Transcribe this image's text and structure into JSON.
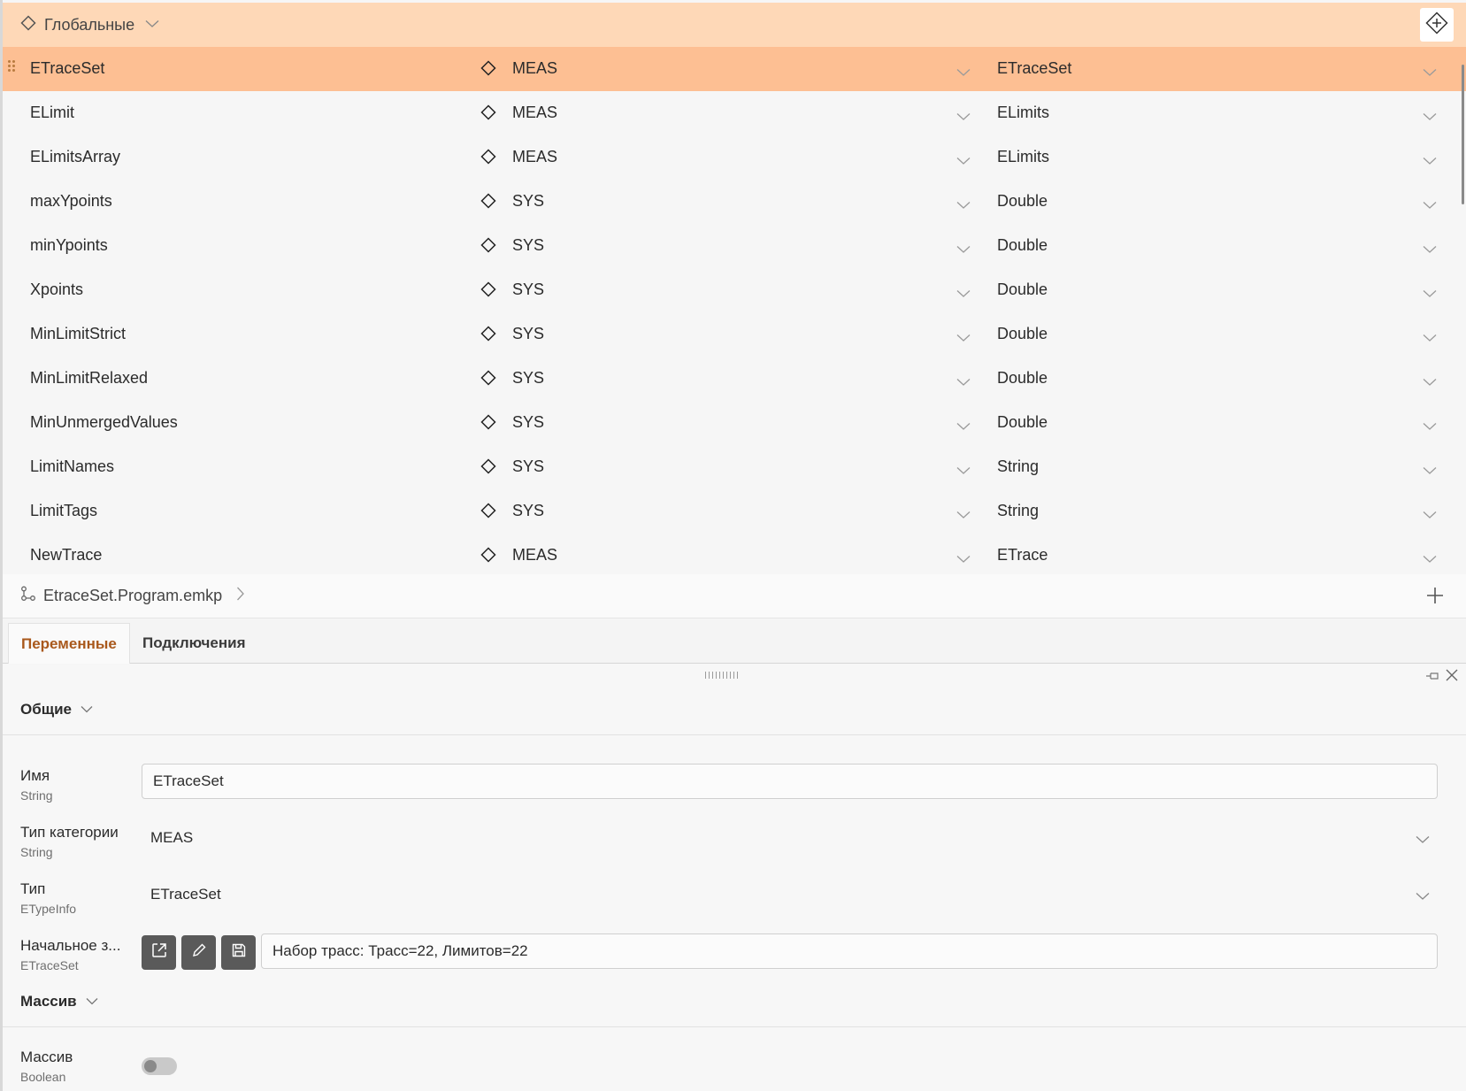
{
  "header": {
    "scope_label": "Глобальные",
    "icons": {
      "scope": "diamond-icon",
      "dropdown": "chevron-down-icon",
      "action": "add-diamond-icon"
    }
  },
  "variables": [
    {
      "name": "ETraceSet",
      "category": "MEAS",
      "type": "ETraceSet",
      "selected": true
    },
    {
      "name": "ELimit",
      "category": "MEAS",
      "type": "ELimits"
    },
    {
      "name": "ELimitsArray",
      "category": "MEAS",
      "type": "ELimits"
    },
    {
      "name": "maxYpoints",
      "category": "SYS",
      "type": "Double"
    },
    {
      "name": "minYpoints",
      "category": "SYS",
      "type": "Double"
    },
    {
      "name": "Xpoints",
      "category": "SYS",
      "type": "Double"
    },
    {
      "name": "MinLimitStrict",
      "category": "SYS",
      "type": "Double"
    },
    {
      "name": "MinLimitRelaxed",
      "category": "SYS",
      "type": "Double"
    },
    {
      "name": "MinUnmergedValues",
      "category": "SYS",
      "type": "Double"
    },
    {
      "name": "LimitNames",
      "category": "SYS",
      "type": "String"
    },
    {
      "name": "LimitTags",
      "category": "SYS",
      "type": "String"
    },
    {
      "name": "NewTrace",
      "category": "MEAS",
      "type": "ETrace"
    }
  ],
  "filebar": {
    "file_name": "EtraceSet.Program.emkp"
  },
  "tabs": [
    {
      "label": "Переменные",
      "active": true
    },
    {
      "label": "Подключения",
      "active": false
    }
  ],
  "panel": {
    "general": {
      "title": "Общие",
      "name": {
        "label": "Имя",
        "type": "String",
        "value": "ETraceSet"
      },
      "category": {
        "label": "Тип категории",
        "type": "String",
        "value": "MEAS"
      },
      "type": {
        "label": "Тип",
        "type": "ETypeInfo",
        "value": "ETraceSet"
      },
      "initial": {
        "label": "Начальное з...",
        "type": "ETraceSet",
        "value": "Набор трасс: Трасс=22, Лимитов=22"
      }
    },
    "array": {
      "title": "Массив",
      "is_array": {
        "label": "Массив",
        "type": "Boolean",
        "value": false
      }
    }
  },
  "colors": {
    "header_bg": "#fed8b7",
    "selected_row_bg": "#fdbf93",
    "active_tab_text": "#a9581b",
    "button_bg": "#5a5a5a"
  }
}
